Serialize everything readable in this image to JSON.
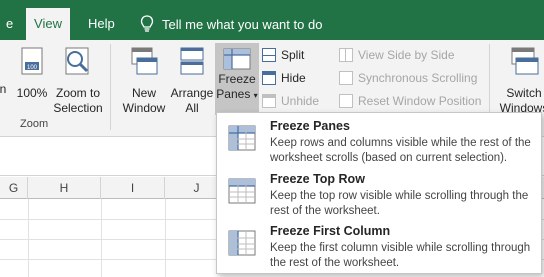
{
  "tabs": [
    {
      "label": "e",
      "active": false
    },
    {
      "label": "View",
      "active": true
    },
    {
      "label": "Help",
      "active": false
    }
  ],
  "tell_me": {
    "placeholder": "Tell me what you want to do",
    "icon": "lightbulb-icon"
  },
  "zoom_group": {
    "label": "Zoom",
    "buttons": [
      {
        "label_1": "n",
        "label_2": ""
      },
      {
        "label_1": "100%",
        "label_2": ""
      },
      {
        "label_1": "Zoom to",
        "label_2": "Selection"
      }
    ]
  },
  "window_group": {
    "new_window": {
      "label_1": "New",
      "label_2": "Window"
    },
    "arrange_all": {
      "label_1": "Arrange",
      "label_2": "All"
    },
    "freeze_panes": {
      "label_1": "Freeze",
      "label_2": "Panes",
      "caret": "▾"
    },
    "small_buttons": [
      {
        "label": "Split",
        "enabled": true
      },
      {
        "label": "Hide",
        "enabled": true
      },
      {
        "label": "Unhide",
        "enabled": false
      },
      {
        "label": "View Side by Side",
        "enabled": false
      },
      {
        "label": "Synchronous Scrolling",
        "enabled": false
      },
      {
        "label": "Reset Window Position",
        "enabled": false
      }
    ],
    "switch_windows": {
      "label_1": "Switch",
      "label_2": "Windows"
    }
  },
  "column_headers": [
    "G",
    "H",
    "I",
    "J"
  ],
  "freeze_menu": {
    "items": [
      {
        "title": "Freeze Panes",
        "description": "Keep rows and columns visible while the rest of the worksheet scrolls (based on current selection)."
      },
      {
        "title": "Freeze Top Row",
        "description": "Keep the top row visible while scrolling through the rest of the worksheet."
      },
      {
        "title": "Freeze First Column",
        "description": "Keep the first column visible while scrolling through the rest of the worksheet."
      }
    ]
  },
  "colors": {
    "accent": "#217346",
    "ribbon_bg": "#f3f3f3",
    "icon_blue": "#4a6e9c"
  }
}
